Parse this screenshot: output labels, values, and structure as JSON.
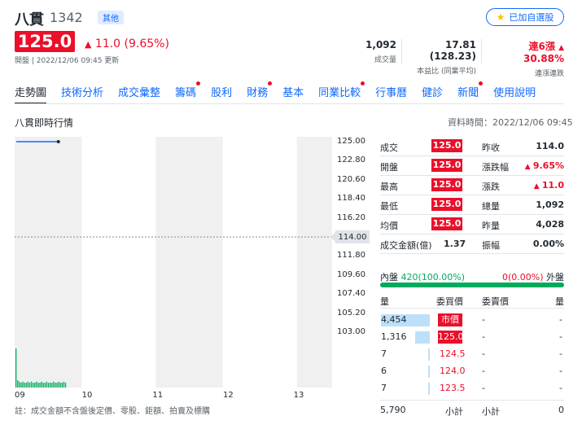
{
  "header": {
    "name": "八貫",
    "code": "1342",
    "tag": "其他",
    "follow_label": "已加自選股",
    "price": "125.0",
    "change": "11.0 (9.65%)",
    "market_time": "開盤 | 2022/12/06 09:45 更新",
    "stats": {
      "volume_value": "1,092",
      "volume_label": "成交量",
      "pe_value": "17.81 (128.23)",
      "pe_label": "本益比 (同業平均)",
      "streak_value": "連6漲",
      "streak_pct": "30.88%",
      "streak_label": "連漲連跌"
    }
  },
  "tabs": [
    {
      "label": "走勢圖",
      "active": true,
      "dot": false
    },
    {
      "label": "技術分析",
      "active": false,
      "dot": false
    },
    {
      "label": "成交彙整",
      "active": false,
      "dot": false
    },
    {
      "label": "籌碼",
      "active": false,
      "dot": true
    },
    {
      "label": "股利",
      "active": false,
      "dot": false
    },
    {
      "label": "財務",
      "active": false,
      "dot": true
    },
    {
      "label": "基本",
      "active": false,
      "dot": false
    },
    {
      "label": "同業比較",
      "active": false,
      "dot": true
    },
    {
      "label": "行事曆",
      "active": false,
      "dot": false
    },
    {
      "label": "健診",
      "active": false,
      "dot": false
    },
    {
      "label": "新聞",
      "active": false,
      "dot": true
    },
    {
      "label": "使用說明",
      "active": false,
      "dot": false
    }
  ],
  "section": {
    "title": "八貫即時行情",
    "data_time": "資料時間：2022/12/06 09:45"
  },
  "chart_data": {
    "type": "line",
    "y_ticks": [
      "125.00",
      "122.80",
      "120.60",
      "118.40",
      "116.20",
      "114.00",
      "111.80",
      "109.60",
      "107.40",
      "105.20",
      "103.00"
    ],
    "x_ticks": [
      "09",
      "10",
      "11",
      "12",
      "13"
    ],
    "ylim": [
      103.0,
      125.0
    ],
    "prev_close": 114.0,
    "prev_close_label": "114.00",
    "series": [
      {
        "x": [
          0,
          0.45
        ],
        "values": [
          125.0,
          125.0
        ]
      }
    ],
    "volume_bars": [
      0.8,
      0.15,
      0.12,
      0.1,
      0.12,
      0.1,
      0.1,
      0.12,
      0.1,
      0.12,
      0.1,
      0.1,
      0.12,
      0.1,
      0.1,
      0.12,
      0.1,
      0.1,
      0.12,
      0.1,
      0.1,
      0.1,
      0.12,
      0.1,
      0.1,
      0.12,
      0.1,
      0.1,
      0.12,
      0.1
    ]
  },
  "quote": {
    "left": [
      {
        "label": "成交",
        "value": "125.0"
      },
      {
        "label": "開盤",
        "value": "125.0"
      },
      {
        "label": "最高",
        "value": "125.0"
      },
      {
        "label": "最低",
        "value": "125.0"
      },
      {
        "label": "均價",
        "value": "125.0"
      },
      {
        "label": "成交金額(億)",
        "value": "1.37"
      }
    ],
    "right": [
      {
        "label": "昨收",
        "value": "114.0",
        "color": "#232a31",
        "arrow": ""
      },
      {
        "label": "漲跌幅",
        "value": "9.65%",
        "color": "#eb0f29",
        "arrow": "▲"
      },
      {
        "label": "漲跌",
        "value": "11.0",
        "color": "#eb0f29",
        "arrow": "▲"
      },
      {
        "label": "總量",
        "value": "1,092",
        "color": "#232a31",
        "arrow": ""
      },
      {
        "label": "昨量",
        "value": "4,028",
        "color": "#232a31",
        "arrow": ""
      },
      {
        "label": "振幅",
        "value": "0.00%",
        "color": "#232a31",
        "arrow": ""
      }
    ]
  },
  "inout": {
    "in_label": "內盤",
    "in_value": "420(100.00%)",
    "out_value": "0(0.00%)",
    "out_label": "外盤"
  },
  "orderbook": {
    "headers": {
      "bid_vol": "量",
      "bid_price": "委買價",
      "ask_price": "委賣價",
      "ask_vol": "量"
    },
    "rows": [
      {
        "bid_vol": "4,454",
        "bid_price": "市價",
        "ask_price": "-",
        "ask_vol": "-",
        "bar": 1.0,
        "market": true
      },
      {
        "bid_vol": "1,316",
        "bid_price": "125.0",
        "ask_price": "-",
        "ask_vol": "-",
        "bar": 0.3,
        "market": true
      },
      {
        "bid_vol": "7",
        "bid_price": "124.5",
        "ask_price": "-",
        "ask_vol": "-",
        "bar": 0.01,
        "market": false
      },
      {
        "bid_vol": "6",
        "bid_price": "124.0",
        "ask_price": "-",
        "ask_vol": "-",
        "bar": 0.01,
        "market": false
      },
      {
        "bid_vol": "7",
        "bid_price": "123.5",
        "ask_price": "-",
        "ask_vol": "-",
        "bar": 0.01,
        "market": false
      }
    ],
    "footer": {
      "bid_total": "5,790",
      "bid_label": "小計",
      "ask_label": "小計",
      "ask_total": "0"
    }
  },
  "footnote": "註：成交金額不含盤後定價、零股、鉅額、拍賣及標購"
}
